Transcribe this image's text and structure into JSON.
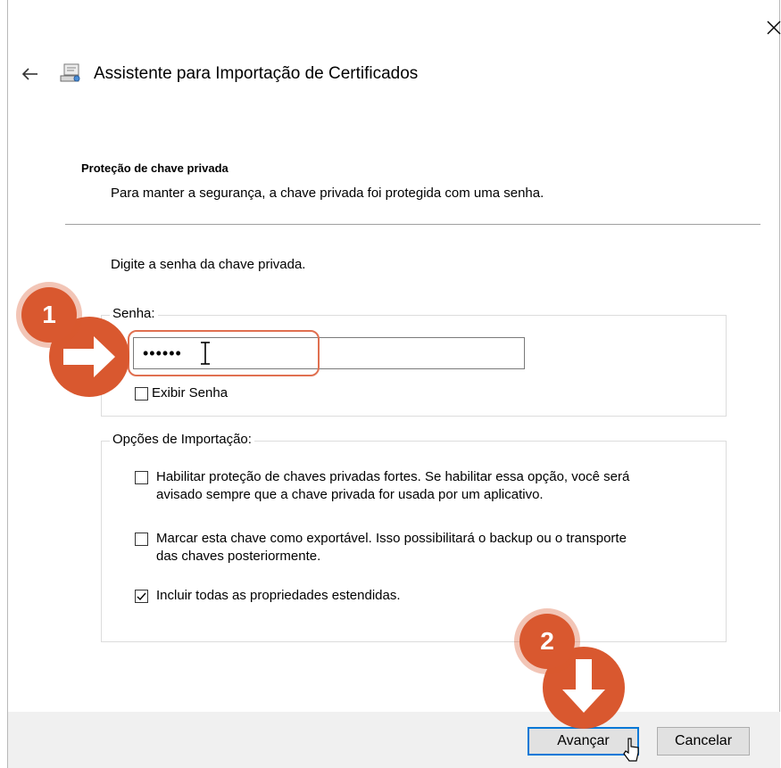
{
  "window": {
    "title": "Assistente para Importação de Certificados",
    "close_icon": "close-icon",
    "back_icon": "back-arrow-icon",
    "wizard_icon": "certificate-wizard-icon"
  },
  "section": {
    "heading": "Proteção de chave privada",
    "description": "Para manter a segurança, a chave privada foi protegida com uma senha."
  },
  "instruction": "Digite a senha da chave privada.",
  "password_group": {
    "legend": "Senha:",
    "value": "••••••",
    "show_password_label": "Exibir Senha",
    "show_password_checked": false
  },
  "import_options": {
    "legend": "Opções de Importação:",
    "options": [
      {
        "label_line1": "Habilitar proteção de chaves privadas fortes. Se habilitar essa opção, você será",
        "label_line2": "avisado sempre que a chave privada for usada por um aplicativo.",
        "checked": false
      },
      {
        "label_line1": "Marcar esta chave como exportável. Isso possibilitará o backup ou o transporte",
        "label_line2": "das chaves posteriormente.",
        "checked": false
      },
      {
        "label_line1": "Incluir todas as propriedades estendidas.",
        "label_line2": "",
        "checked": true
      }
    ]
  },
  "buttons": {
    "next": "Avançar",
    "cancel": "Cancelar"
  },
  "annotations": {
    "step1": "1",
    "step2": "2",
    "color": "#d9582f"
  }
}
